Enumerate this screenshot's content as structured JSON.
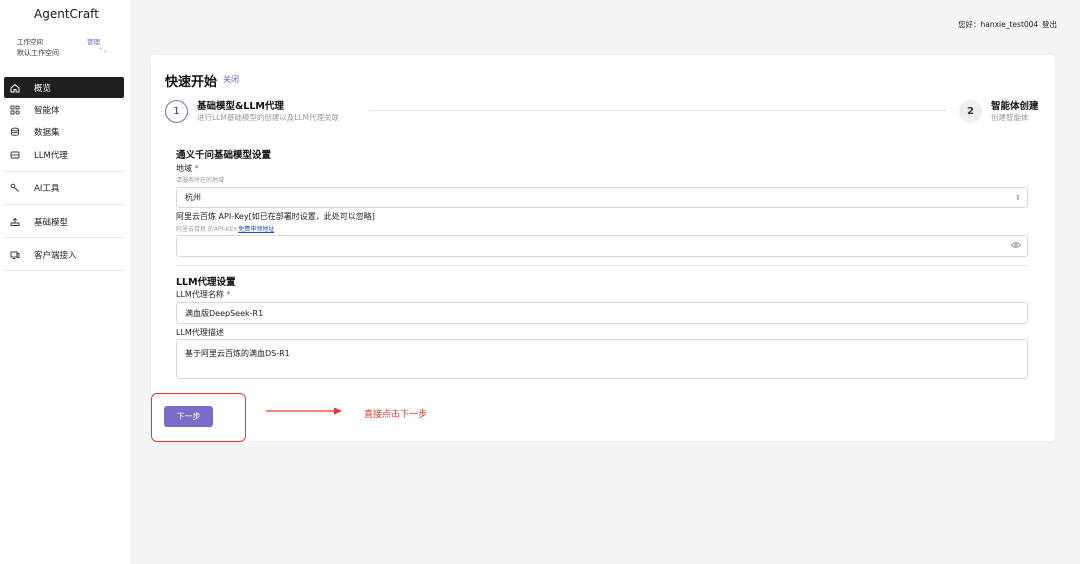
{
  "app": {
    "title": "AgentCraft"
  },
  "workspace": {
    "label": "工作空间",
    "manage": "管理",
    "current": "默认工作空间"
  },
  "header": {
    "greeting": "您好：hanxie_test004",
    "logout": "登出"
  },
  "sidebar": {
    "items": [
      {
        "label": "概览",
        "icon": "home-icon",
        "active": true
      },
      {
        "label": "智能体",
        "icon": "apps-icon"
      },
      {
        "label": "数据集",
        "icon": "database-icon"
      },
      {
        "label": "LLM代理",
        "icon": "llm-proxy-icon"
      },
      {
        "label": "AI工具",
        "icon": "tool-icon"
      },
      {
        "label": "基础模型",
        "icon": "model-icon"
      },
      {
        "label": "客户端接入",
        "icon": "client-icon"
      }
    ]
  },
  "quickstart": {
    "title": "快速开始",
    "close": "关闭",
    "steps": [
      {
        "num": "1",
        "title": "基础模型&LLM代理",
        "desc": "进行LLM基础模型的创建以及LLM代理关联"
      },
      {
        "num": "2",
        "title": "智能体创建",
        "desc": "创建智能体"
      }
    ],
    "model_section": {
      "title": "通义千问基础模型设置",
      "region_label": "地域",
      "region_hint": "请服务所在的地域",
      "region_value": "杭州",
      "apikey_label": "阿里云百炼 API-Key[如已在部署时设置，此处可以忽略]",
      "apikey_hint": "阿里云百炼 的API-KEY:",
      "apikey_link": "免费申领地址",
      "apikey_value": ""
    },
    "proxy_section": {
      "title": "LLM代理设置",
      "name_label": "LLM代理名称",
      "name_value": "满血版DeepSeek-R1",
      "desc_label": "LLM代理描述",
      "desc_value": "基于阿里云百炼的满血DS-R1"
    },
    "next_button": "下一步"
  },
  "annotation": {
    "text": "直接点击下一步",
    "color": "#e03a2f"
  },
  "colors": {
    "accent": "#7b6cc9",
    "active_nav": "#1f1f1f",
    "annotation": "#e03a2f"
  }
}
